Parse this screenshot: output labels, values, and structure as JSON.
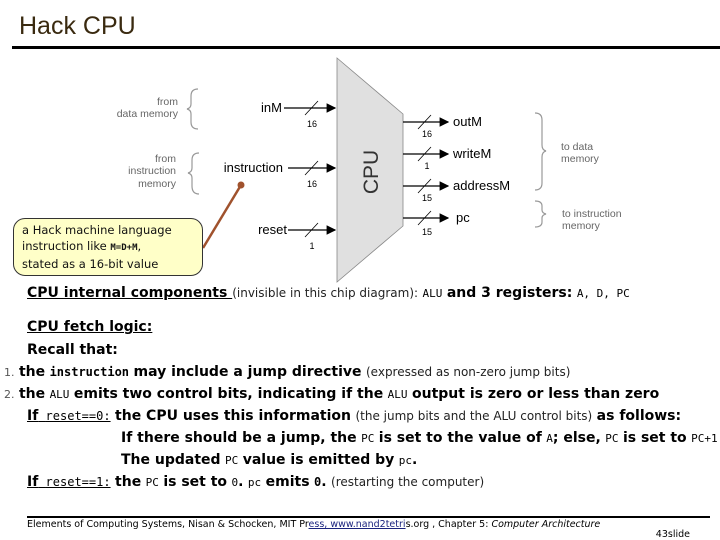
{
  "slide_title": "Hack CPU",
  "diagram": {
    "chip_label": "CPU",
    "inputs": [
      {
        "name": "inM",
        "width": "16",
        "source": [
          "from",
          "data memory"
        ]
      },
      {
        "name": "instruction",
        "width": "16",
        "source": [
          "from",
          "instruction",
          "memory"
        ]
      },
      {
        "name": "reset",
        "width": "1"
      }
    ],
    "outputs": [
      {
        "name": "outM",
        "width": "16"
      },
      {
        "name": "writeM",
        "width": "1"
      },
      {
        "name": "addressM",
        "width": "15"
      },
      {
        "name": "pc",
        "width": "15"
      }
    ],
    "dest_data_memory": [
      "to data",
      "memory"
    ],
    "dest_instruction_memory": [
      "to instruction",
      "memory"
    ],
    "accent_color": "#a0522d"
  },
  "callout": {
    "line1": "a Hack machine language",
    "line2_pre": "instruction like ",
    "line2_code": "M=D+M",
    "line2_post": ",",
    "line3": "stated as a 16-bit value"
  },
  "internal": {
    "heading": "CPU internal components ",
    "note": "(invisible in this chip diagram):",
    "alu": "ALU",
    "and_text": "and 3 registers:",
    "registers": "A, D, PC"
  },
  "fetch": {
    "heading": "CPU fetch logic:",
    "recall": "Recall that:",
    "item1": {
      "num": "1.",
      "t1": "the",
      "code": "instruction",
      "t2": "may include a jump directive",
      "note": "(expressed as non-zero jump bits)"
    },
    "item2": {
      "num": "2.",
      "t1": "the",
      "code1": "ALU",
      "t2": "emits two control bits, indicating if the",
      "code2": "ALU",
      "t3": "output is zero or less than zero"
    },
    "reset0": {
      "label_if": "If",
      "label_cond": "reset==0:",
      "t1": "the CPU uses this information",
      "note": "(the jump bits and the ALU control bits)",
      "t2": "as follows:"
    },
    "jump_line": {
      "t1": "If there should be a jump, the",
      "c1": "PC",
      "t2": "is set to the value of",
      "c2": "A",
      "t3": "; else,",
      "c3": "PC",
      "t4": "is set to",
      "c4": "PC+1"
    },
    "updated_line": {
      "t1": "The updated",
      "c1": "PC",
      "t2": "value is emitted by",
      "c2": "pc",
      "t3": "."
    },
    "reset1": {
      "label_if": "If",
      "label_cond": "reset==1:",
      "t1": "the",
      "c1": "PC",
      "t2": "is set to",
      "c2": "0",
      "t3": ".",
      "c3": "pc",
      "t4": "emits",
      "c4": "0",
      "t5": ".",
      "note": "(restarting the computer)"
    }
  },
  "footer": {
    "pre": "Elements of Computing Systems, Nisan & Schocken, MIT Pr",
    "link": "ess, www.nand2tetri",
    "post": "s.org , Chapter 5: ",
    "chapter": "Computer Architecture",
    "slide": "43slide"
  }
}
